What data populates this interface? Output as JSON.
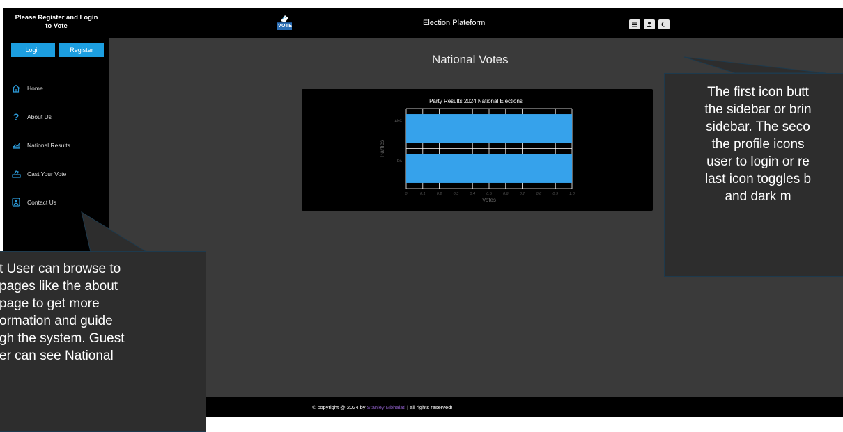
{
  "sidebar": {
    "title_line1": "Please Register and Login",
    "title_line2": "to Vote",
    "login_label": "Login",
    "register_label": "Register",
    "items": [
      {
        "label": "Home",
        "icon": "home-icon"
      },
      {
        "label": "About Us",
        "icon": "question-icon"
      },
      {
        "label": "National Results",
        "icon": "chart-icon"
      },
      {
        "label": "Cast Your Vote",
        "icon": "ballot-icon"
      },
      {
        "label": "Contact Us",
        "icon": "contact-icon"
      }
    ]
  },
  "header": {
    "logo_text": "VOTE",
    "title": "Election Plateform",
    "icons": [
      "menu-icon",
      "user-icon",
      "moon-icon"
    ]
  },
  "main": {
    "page_title": "National Votes"
  },
  "chart_data": {
    "type": "bar",
    "orientation": "horizontal",
    "title": "Party Results 2024 National Elections",
    "categories": [
      "ANC",
      "DA"
    ],
    "values": [
      1.0,
      1.0
    ],
    "xlabel": "Votes",
    "ylabel": "Parties",
    "xlim": [
      0,
      1.0
    ],
    "xticks": [
      "0",
      "0.1",
      "0.2",
      "0.3",
      "0.4",
      "0.5",
      "0.6",
      "0.7",
      "0.8",
      "0.9",
      "1.0"
    ],
    "bar_color": "#36a2eb",
    "grid": true
  },
  "footer": {
    "prefix": "© copyright @ 2024 by ",
    "author": "Stanley Mbhalati",
    "suffix": " | all rights reserved!"
  },
  "callouts": {
    "right": [
      "The first icon butt",
      "the sidebar or brin",
      "sidebar. The seco",
      "the profile icons",
      "user to login or re",
      "last icon toggles b",
      "and dark m"
    ],
    "left": [
      "t User can browse to",
      " pages like the about",
      "page to get more",
      "ormation and guide",
      "gh the system. Guest",
      "er can see National"
    ]
  },
  "colors": {
    "accent": "#1c9ee0",
    "bar": "#36a2eb",
    "author_link": "#8a5cc2"
  }
}
